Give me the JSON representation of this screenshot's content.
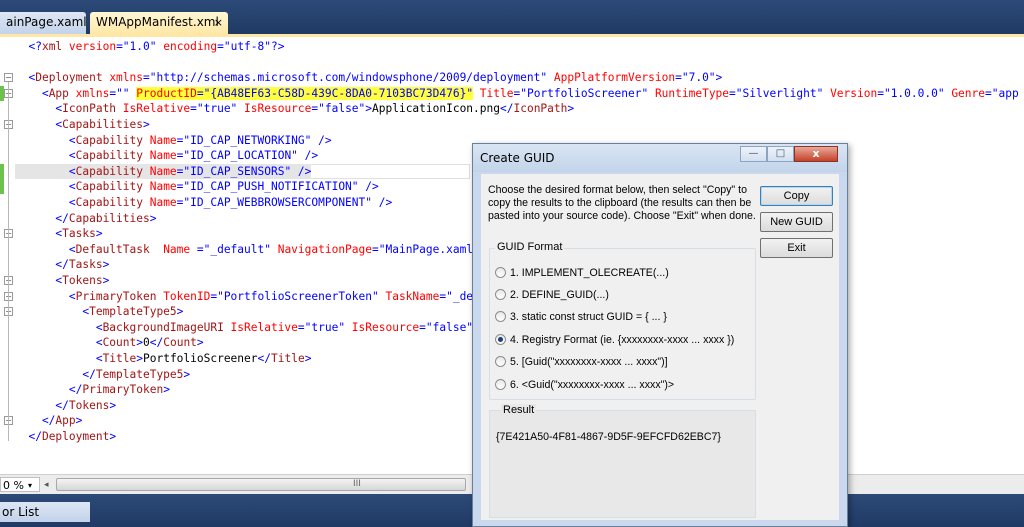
{
  "tabs": [
    {
      "label": "ainPage.xaml"
    },
    {
      "label": "WMAppManifest.xml",
      "close": "×"
    }
  ],
  "code_lines": [
    [
      {
        "c": "bl",
        "t": "  <?"
      },
      {
        "c": "mr",
        "t": "xml"
      },
      {
        "c": "rd",
        "t": " version"
      },
      {
        "c": "bl",
        "t": "=\"1.0\""
      },
      {
        "c": "rd",
        "t": " encoding"
      },
      {
        "c": "bl",
        "t": "=\"utf-8\"?>"
      }
    ],
    [],
    [
      {
        "c": "bl",
        "t": "  <"
      },
      {
        "c": "mr",
        "t": "Deployment"
      },
      {
        "c": "rd",
        "t": " xmlns"
      },
      {
        "c": "bl",
        "t": "=\"http://schemas.microsoft.com/windowsphone/2009/deployment\""
      },
      {
        "c": "rd",
        "t": " AppPlatformVersion"
      },
      {
        "c": "bl",
        "t": "=\"7.0\">"
      }
    ],
    [
      {
        "c": "bl",
        "t": "    <"
      },
      {
        "c": "mr",
        "t": "App"
      },
      {
        "c": "rd",
        "t": " xmlns"
      },
      {
        "c": "bl",
        "t": "=\"\" "
      },
      {
        "c": "rd hl",
        "t": "ProductID"
      },
      {
        "c": "bl hl",
        "t": "=\"{AB48EF63-C58D-439C-8DA0-7103BC73D476}\""
      },
      {
        "c": "rd",
        "t": " Title"
      },
      {
        "c": "bl",
        "t": "=\"PortfolioScreener\""
      },
      {
        "c": "rd",
        "t": " RuntimeType"
      },
      {
        "c": "bl",
        "t": "=\"Silverlight\""
      },
      {
        "c": "rd",
        "t": " Version"
      },
      {
        "c": "bl",
        "t": "=\"1.0.0.0\""
      },
      {
        "c": "rd",
        "t": " Genre"
      },
      {
        "c": "bl",
        "t": "=\"app"
      }
    ],
    [
      {
        "c": "bl",
        "t": "      <"
      },
      {
        "c": "mr",
        "t": "IconPath"
      },
      {
        "c": "rd",
        "t": " IsRelative"
      },
      {
        "c": "bl",
        "t": "=\"true\""
      },
      {
        "c": "rd",
        "t": " IsResource"
      },
      {
        "c": "bl",
        "t": "=\"false\">"
      },
      {
        "c": "tx",
        "t": "ApplicationIcon.png"
      },
      {
        "c": "bl",
        "t": "</"
      },
      {
        "c": "mr",
        "t": "IconPath"
      },
      {
        "c": "bl",
        "t": ">"
      }
    ],
    [
      {
        "c": "bl",
        "t": "      <"
      },
      {
        "c": "mr",
        "t": "Capabilities"
      },
      {
        "c": "bl",
        "t": ">"
      }
    ],
    [
      {
        "c": "bl",
        "t": "        <"
      },
      {
        "c": "mr",
        "t": "Capability"
      },
      {
        "c": "rd",
        "t": " Name"
      },
      {
        "c": "bl",
        "t": "=\"ID_CAP_NETWORKING\" />"
      }
    ],
    [
      {
        "c": "bl",
        "t": "        <"
      },
      {
        "c": "mr",
        "t": "Capability"
      },
      {
        "c": "rd",
        "t": " Name"
      },
      {
        "c": "bl",
        "t": "=\"ID_CAP_LOCATION\" />"
      }
    ],
    [
      {
        "c": "bl",
        "t": "        <"
      },
      {
        "c": "mr",
        "t": "Capability"
      },
      {
        "c": "rd",
        "t": " Name"
      },
      {
        "c": "bl",
        "t": "=\"ID_CAP_SENSORS\" />"
      }
    ],
    [
      {
        "c": "bl",
        "t": "        <"
      },
      {
        "c": "mr",
        "t": "Capability"
      },
      {
        "c": "rd",
        "t": " Name"
      },
      {
        "c": "bl",
        "t": "=\"ID_CAP_PUSH_NOTIFICATION\" />"
      }
    ],
    [
      {
        "c": "bl",
        "t": "        <"
      },
      {
        "c": "mr",
        "t": "Capability"
      },
      {
        "c": "rd",
        "t": " Name"
      },
      {
        "c": "bl",
        "t": "=\"ID_CAP_WEBBROWSERCOMPONENT\" />"
      }
    ],
    [
      {
        "c": "bl",
        "t": "      </"
      },
      {
        "c": "mr",
        "t": "Capabilities"
      },
      {
        "c": "bl",
        "t": ">"
      }
    ],
    [
      {
        "c": "bl",
        "t": "      <"
      },
      {
        "c": "mr",
        "t": "Tasks"
      },
      {
        "c": "bl",
        "t": ">"
      }
    ],
    [
      {
        "c": "bl",
        "t": "        <"
      },
      {
        "c": "mr",
        "t": "DefaultTask"
      },
      {
        "c": "rd",
        "t": "  Name"
      },
      {
        "c": "bl",
        "t": " =\"_default\""
      },
      {
        "c": "rd",
        "t": " NavigationPage"
      },
      {
        "c": "bl",
        "t": "=\"MainPage.xaml"
      }
    ],
    [
      {
        "c": "bl",
        "t": "      </"
      },
      {
        "c": "mr",
        "t": "Tasks"
      },
      {
        "c": "bl",
        "t": ">"
      }
    ],
    [
      {
        "c": "bl",
        "t": "      <"
      },
      {
        "c": "mr",
        "t": "Tokens"
      },
      {
        "c": "bl",
        "t": ">"
      }
    ],
    [
      {
        "c": "bl",
        "t": "        <"
      },
      {
        "c": "mr",
        "t": "PrimaryToken"
      },
      {
        "c": "rd",
        "t": " TokenID"
      },
      {
        "c": "bl",
        "t": "=\"PortfolioScreenerToken\""
      },
      {
        "c": "rd",
        "t": " TaskName"
      },
      {
        "c": "bl",
        "t": "=\"_def"
      }
    ],
    [
      {
        "c": "bl",
        "t": "          <"
      },
      {
        "c": "mr",
        "t": "TemplateType5"
      },
      {
        "c": "bl",
        "t": ">"
      }
    ],
    [
      {
        "c": "bl",
        "t": "            <"
      },
      {
        "c": "mr",
        "t": "BackgroundImageURI"
      },
      {
        "c": "rd",
        "t": " IsRelative"
      },
      {
        "c": "bl",
        "t": "=\"true\""
      },
      {
        "c": "rd",
        "t": " IsResource"
      },
      {
        "c": "bl",
        "t": "=\"false\""
      }
    ],
    [
      {
        "c": "bl",
        "t": "            <"
      },
      {
        "c": "mr",
        "t": "Count"
      },
      {
        "c": "bl",
        "t": ">"
      },
      {
        "c": "tx",
        "t": "0"
      },
      {
        "c": "bl",
        "t": "</"
      },
      {
        "c": "mr",
        "t": "Count"
      },
      {
        "c": "bl",
        "t": ">"
      }
    ],
    [
      {
        "c": "bl",
        "t": "            <"
      },
      {
        "c": "mr",
        "t": "Title"
      },
      {
        "c": "bl",
        "t": ">"
      },
      {
        "c": "tx",
        "t": "PortfolioScreener"
      },
      {
        "c": "bl",
        "t": "</"
      },
      {
        "c": "mr",
        "t": "Title"
      },
      {
        "c": "bl",
        "t": ">"
      }
    ],
    [
      {
        "c": "bl",
        "t": "          </"
      },
      {
        "c": "mr",
        "t": "TemplateType5"
      },
      {
        "c": "bl",
        "t": ">"
      }
    ],
    [
      {
        "c": "bl",
        "t": "        </"
      },
      {
        "c": "mr",
        "t": "PrimaryToken"
      },
      {
        "c": "bl",
        "t": ">"
      }
    ],
    [
      {
        "c": "bl",
        "t": "      </"
      },
      {
        "c": "mr",
        "t": "Tokens"
      },
      {
        "c": "bl",
        "t": ">"
      }
    ],
    [
      {
        "c": "bl",
        "t": "    </"
      },
      {
        "c": "mr",
        "t": "App"
      },
      {
        "c": "bl",
        "t": ">"
      }
    ],
    [
      {
        "c": "bl",
        "t": "  </"
      },
      {
        "c": "mr",
        "t": "Deployment"
      },
      {
        "c": "bl",
        "t": ">"
      }
    ]
  ],
  "status": {
    "zoom": "0 %",
    "zoom_drop": "▾",
    "scroll_left": "◂",
    "grip": "III"
  },
  "bottom_panel": {
    "tab_label": "or List"
  },
  "dialog": {
    "title": "Create GUID",
    "min": "—",
    "max": "□",
    "close": "x",
    "description": "Choose the desired format below, then select \"Copy\" to copy the results to the clipboard (the results can then be pasted into your source code).  Choose \"Exit\" when done.",
    "buttons": {
      "copy": "Copy",
      "new_guid": "New GUID",
      "exit": "Exit"
    },
    "format_label": "GUID Format",
    "formats": [
      "1. IMPLEMENT_OLECREATE(...)",
      "2. DEFINE_GUID(...)",
      "3. static const struct GUID = { ... }",
      "4. Registry Format (ie. {xxxxxxxx-xxxx ... xxxx })",
      "5. [Guid(\"xxxxxxxx-xxxx ... xxxx\")]",
      "6. <Guid(\"xxxxxxxx-xxxx ... xxxx\")>"
    ],
    "selected_format": 4,
    "result_label": "Result",
    "result_value": "{7E421A50-4F81-4867-9D5F-9EFCFD62EBC7}"
  },
  "colors": {
    "tag": "#a31515",
    "attr": "#ff0000",
    "value": "#0000ff",
    "highlight": "#ffff3c",
    "chrome": "#2d4a78"
  }
}
